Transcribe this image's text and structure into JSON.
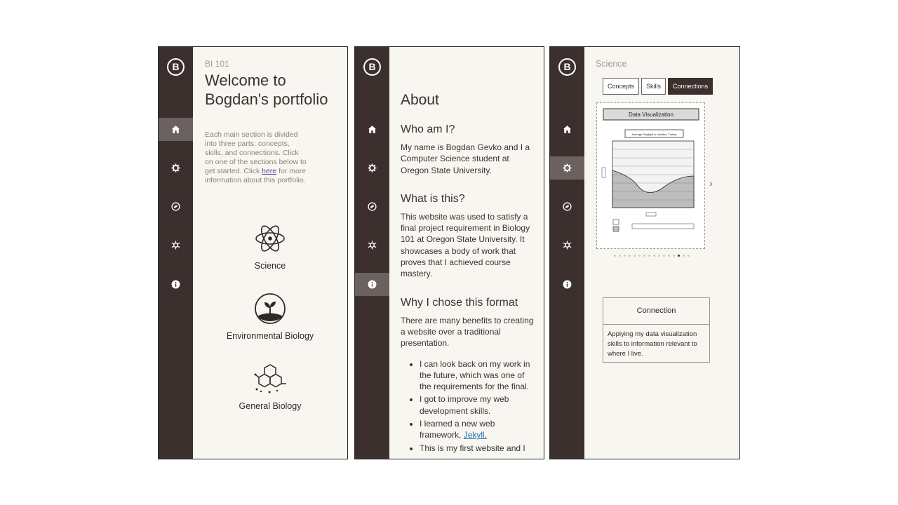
{
  "logo_letter": "B",
  "screen1": {
    "course_code": "BI 101",
    "title": "Welcome to Bogdan's portfolio",
    "intro_before_link": "Each main section is divided into three parts: concepts, skills, and connections. Click on one of the sections below to get started. Click ",
    "intro_link": "here",
    "intro_after_link": " for more information about this portfolio.",
    "sections": [
      {
        "label": "Science",
        "icon": "atom-icon"
      },
      {
        "label": "Environmental Biology",
        "icon": "sprout-icon"
      },
      {
        "label": "General Biology",
        "icon": "molecule-icon"
      }
    ]
  },
  "screen2": {
    "heading": "About",
    "who_heading": "Who am I?",
    "who_text": "My name is Bogdan Gevko and I a Computer Science student at Oregon State University.",
    "what_heading": "What is this?",
    "what_text": "This website was used to satisfy a final project requirement in Biology 101 at Oregon State University. It showcases a body of work that proves that I achieved course mastery.",
    "why_heading": "Why I chose this format",
    "why_text": "There are many benefits to creating a website over a traditional presentation.",
    "bullet1": "I can look back on my work in the future, which was one of the requirements for the final.",
    "bullet2": "I got to improve my web development skills.",
    "bullet3_before_link": "I learned a new web framework, ",
    "bullet3_link": "Jekyll.",
    "bullet4": "This is my first website and I"
  },
  "screen3": {
    "section_title": "Science",
    "tabs": [
      "Concepts",
      "Skills",
      "Connections"
    ],
    "selected_tab": "Connections",
    "card_title": "Data Visualization",
    "chart_title": "Average Daylight in Istanbul, Turkey",
    "slide_count": 16,
    "active_slide_index": 13,
    "connection_heading": "Connection",
    "connection_text": "Applying my data visualization skills to information relevant to where I live."
  },
  "nav_icons": [
    "home-icon",
    "gear-icon",
    "leaf-icon",
    "virus-icon",
    "info-icon"
  ],
  "colors": {
    "sidebar": "#3b302d",
    "active_nav": "#6b625f",
    "background": "#f7f6f0",
    "link": "#2a6fb3"
  }
}
